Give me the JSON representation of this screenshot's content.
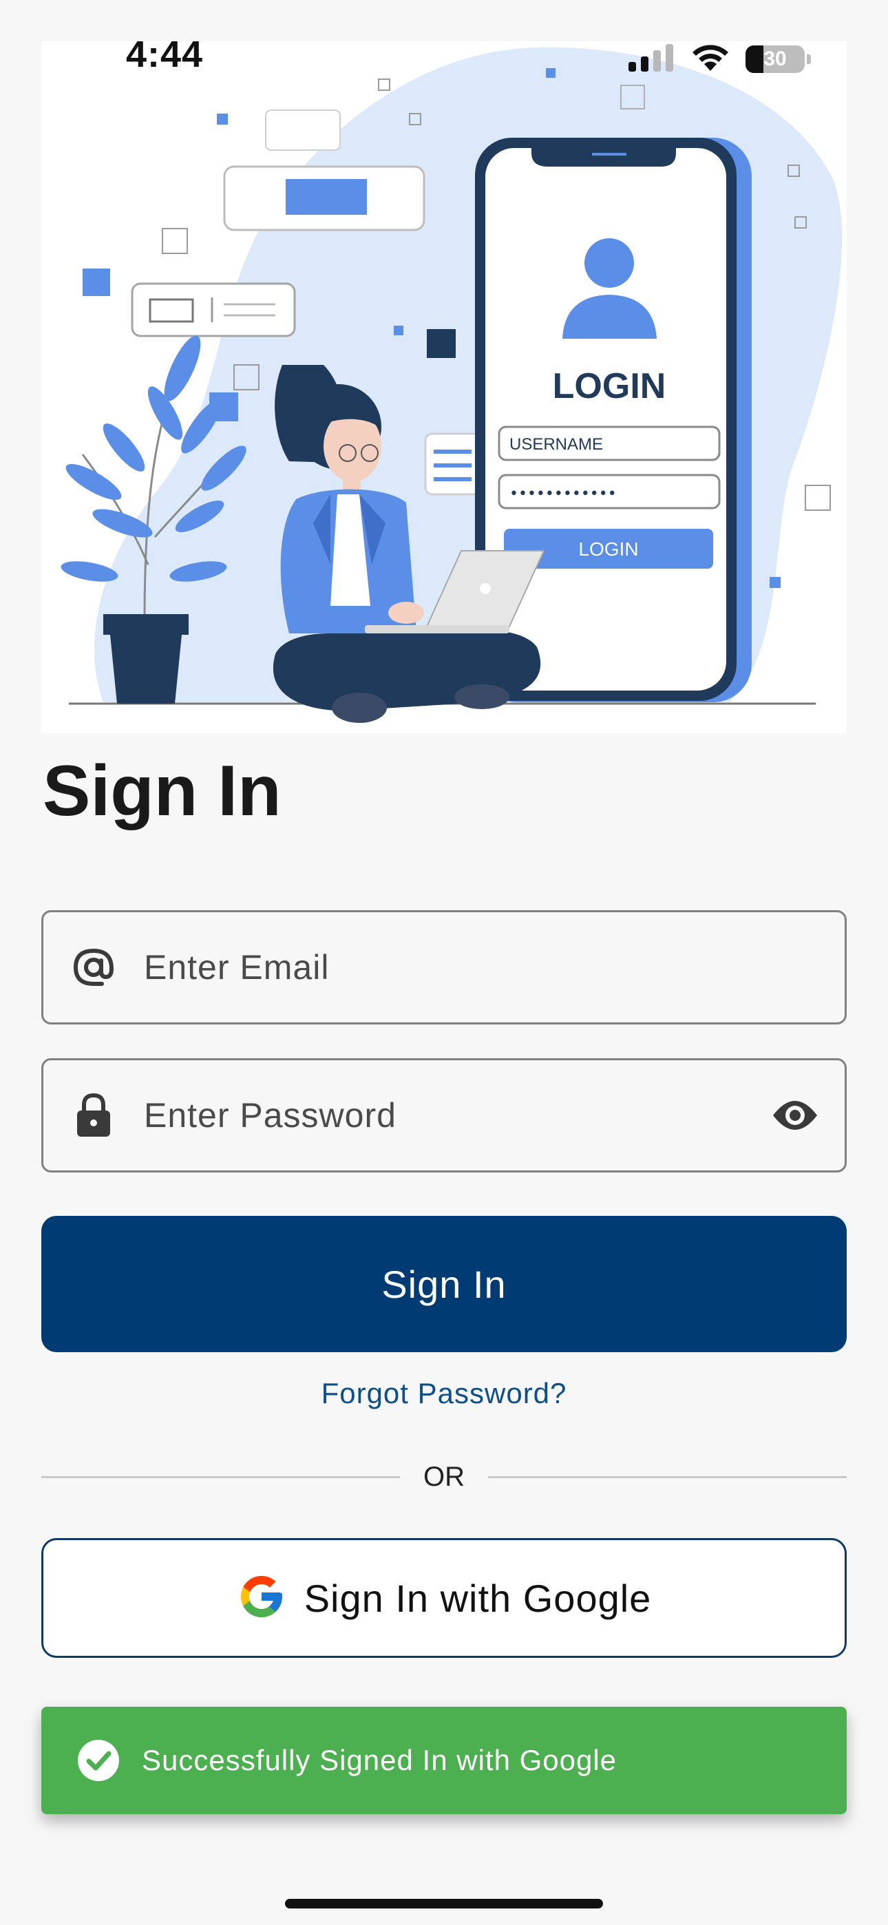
{
  "status_bar": {
    "time": "4:44",
    "battery": "30",
    "battery_level_percent": 30,
    "icons": [
      "cellular-signal-icon",
      "wifi-icon",
      "battery-icon"
    ]
  },
  "hero": {
    "icon": "login-illustration",
    "screen_title": "LOGIN",
    "username_label": "USERNAME",
    "password_mask": "••••••••••••",
    "login_button": "LOGIN"
  },
  "page": {
    "title": "Sign In"
  },
  "form": {
    "email": {
      "icon": "at-sign-icon",
      "placeholder": "Enter Email",
      "value": ""
    },
    "password": {
      "icon": "lock-icon",
      "placeholder": "Enter Password",
      "value": "",
      "toggle_icon": "eye-icon"
    },
    "submit_label": "Sign In",
    "forgot_label": "Forgot Password?"
  },
  "divider": {
    "text": "OR"
  },
  "google": {
    "icon": "google-logo-icon",
    "label": "Sign In with Google"
  },
  "snackbar": {
    "icon": "check-circle-icon",
    "message": "Successfully Signed In with Google"
  },
  "colors": {
    "primary": "#003b73",
    "link": "#0d4f8b",
    "success": "#4caf50",
    "illustration_blue": "#5b8ee6",
    "illustration_navy": "#1f3a5a"
  }
}
